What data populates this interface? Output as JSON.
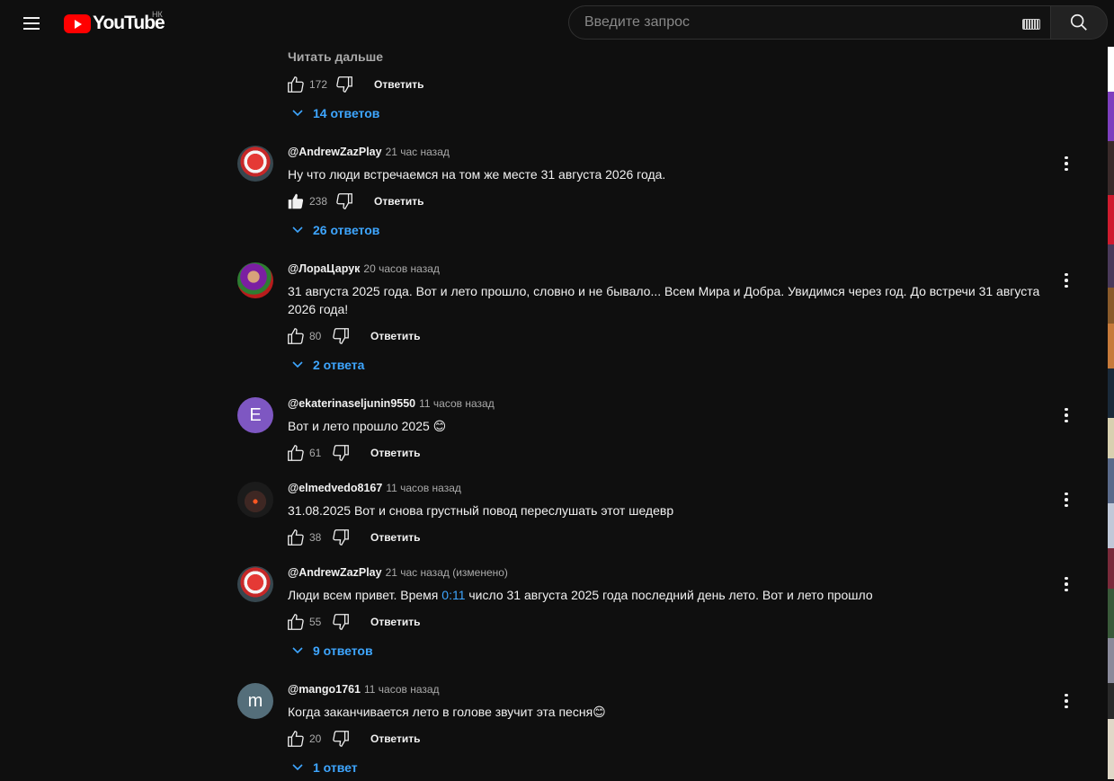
{
  "header": {
    "logo_text": "YouTube",
    "country_code": "НК",
    "search_placeholder": "Введите запрос"
  },
  "top_partial": {
    "read_more": "Читать дальше",
    "likes": "172",
    "reply": "Ответить",
    "replies": "14 ответов"
  },
  "comments": [
    {
      "author": "@AndrewZazPlay",
      "time": "21 час назад",
      "text": "Ну что люди встречаемся на том же месте 31 августа 2026 года.",
      "likes": "238",
      "liked": true,
      "reply": "Ответить",
      "replies": "26 ответов"
    },
    {
      "author": "@ЛораЦарук",
      "time": "20 часов назад",
      "text": "31 августа 2025 года. Вот и лето прошло, словно и не бывало... Всем Мира и Добра. Увидимся через год. До встречи 31 августа 2026 года!",
      "likes": "80",
      "reply": "Ответить",
      "replies": "2 ответа"
    },
    {
      "author": "@ekaterinaseljunin9550",
      "time": "11 часов назад",
      "text": "Вот и лето прошло 2025 😊",
      "likes": "61",
      "reply": "Ответить",
      "avatar_letter": "E",
      "avatar_color": "#7e57c2"
    },
    {
      "author": "@elmedvedo8167",
      "time": "11 часов назад",
      "text": "31.08.2025 Вот и снова грустный повод переслушать этот шедевр",
      "likes": "38",
      "reply": "Ответить"
    },
    {
      "author": "@AndrewZazPlay",
      "time": "21 час назад (изменено)",
      "text_before": "Люди всем привет. Время ",
      "timestamp_link": "0:11",
      "text_after": " число 31 августа 2025 года последний день лето. Вот и лето прошло",
      "likes": "55",
      "reply": "Ответить",
      "replies": "9 ответов"
    },
    {
      "author": "@mango1761",
      "time": "11 часов назад",
      "text": "Когда заканчивается лето в голове звучит эта песня😊",
      "likes": "20",
      "reply": "Ответить",
      "replies": "1 ответ",
      "avatar_letter": "m",
      "avatar_color": "#546e7a"
    }
  ],
  "colors": {
    "background": "#0f0f0f",
    "link": "#3ea6ff",
    "brand_red": "#ff0000"
  }
}
